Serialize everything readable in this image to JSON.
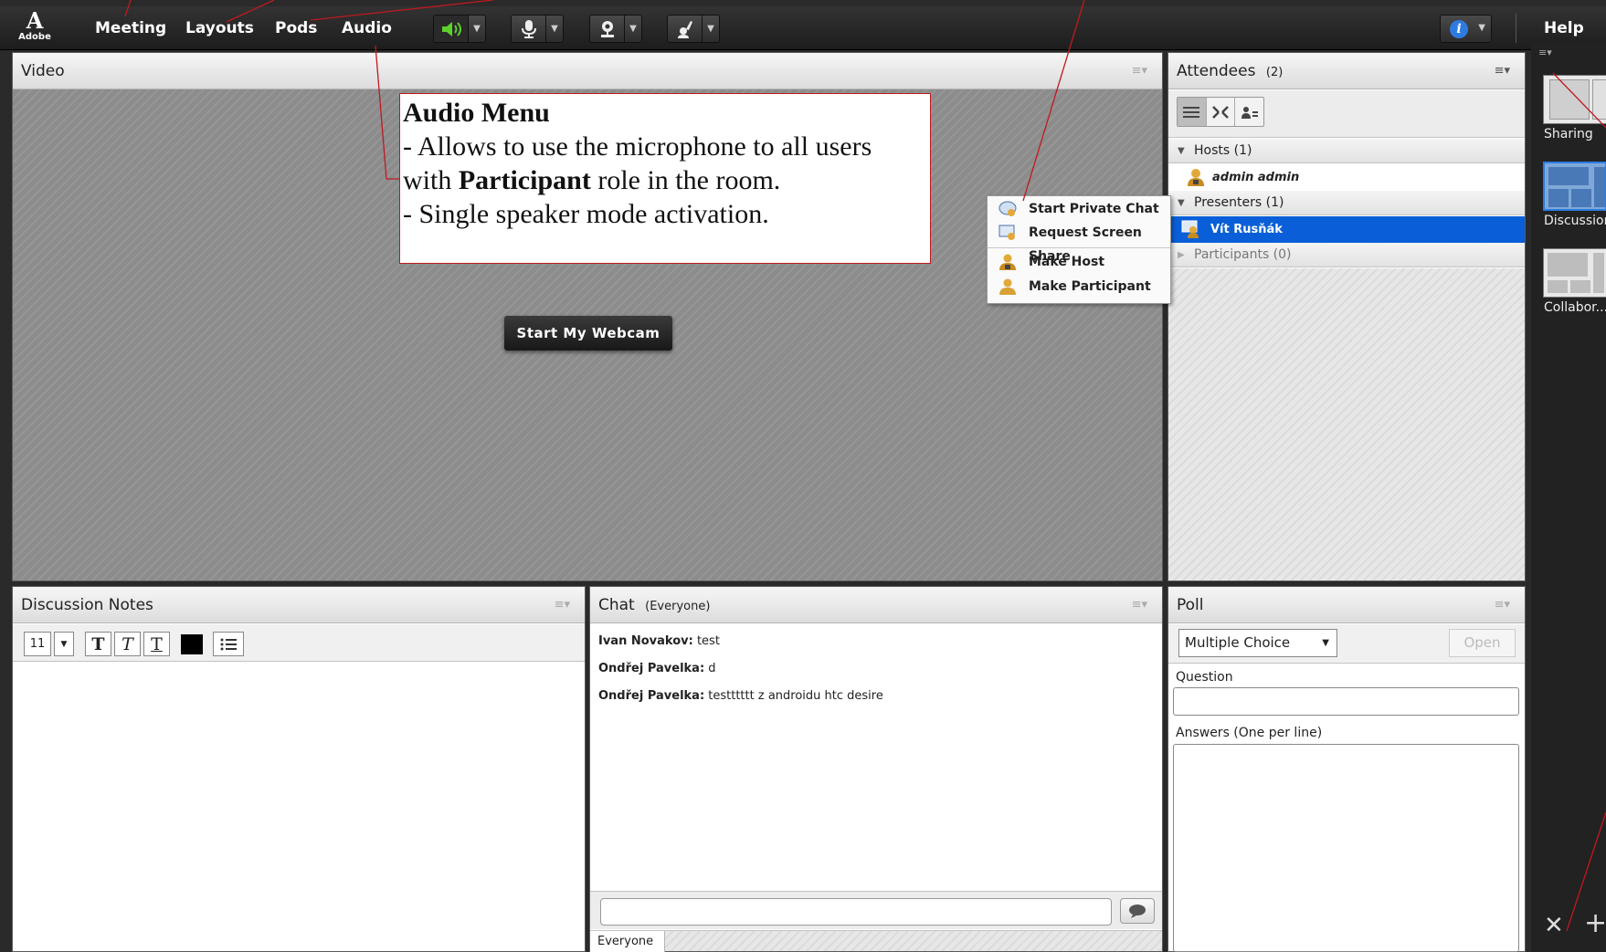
{
  "app": {
    "logo_text": "Adobe",
    "logo_glyph": "A"
  },
  "toolbar": {
    "menus": [
      "Meeting",
      "Layouts",
      "Pods",
      "Audio"
    ],
    "help_label": "Help"
  },
  "video_pod": {
    "title": "Video",
    "webcam_button": "Start My Webcam"
  },
  "annotation": {
    "heading": "Audio Menu",
    "line1": "- Allows to use the microphone to all users",
    "line2_pre": "with ",
    "line2_bold": "Participant",
    "line2_post": " role in the room.",
    "line3": "- Single speaker mode activation."
  },
  "context_menu": {
    "items": [
      "Start Private Chat",
      "Request Screen Share",
      "Make Host",
      "Make Participant"
    ]
  },
  "attendees": {
    "title": "Attendees",
    "count": "(2)",
    "groups": [
      {
        "label": "Hosts (1)",
        "members": [
          "admin admin"
        ]
      },
      {
        "label": "Presenters (1)",
        "members": [
          "Vít Rusňák"
        ]
      },
      {
        "label": "Participants (0)",
        "members": []
      }
    ]
  },
  "notes_pod": {
    "title": "Discussion Notes",
    "font_size": "11"
  },
  "chat_pod": {
    "title": "Chat",
    "scope": "(Everyone)",
    "messages": [
      {
        "author": "Ivan Novakov:",
        "text": " test"
      },
      {
        "author": "Ondřej Pavelka:",
        "text": " d"
      },
      {
        "author": "Ondřej Pavelka:",
        "text": " testttttt z androidu htc desire"
      }
    ],
    "tab": "Everyone"
  },
  "poll_pod": {
    "title": "Poll",
    "type_select": "Multiple Choice",
    "open_button": "Open",
    "question_label": "Question",
    "answers_label": "Answers (One per line)"
  },
  "layouts_rail": {
    "items": [
      "Sharing",
      "Discussion",
      "Collabor..."
    ]
  },
  "colors": {
    "accent_blue": "#0a5fd8",
    "annotation_red": "#c0191f",
    "speaker_green": "#4cd137"
  }
}
